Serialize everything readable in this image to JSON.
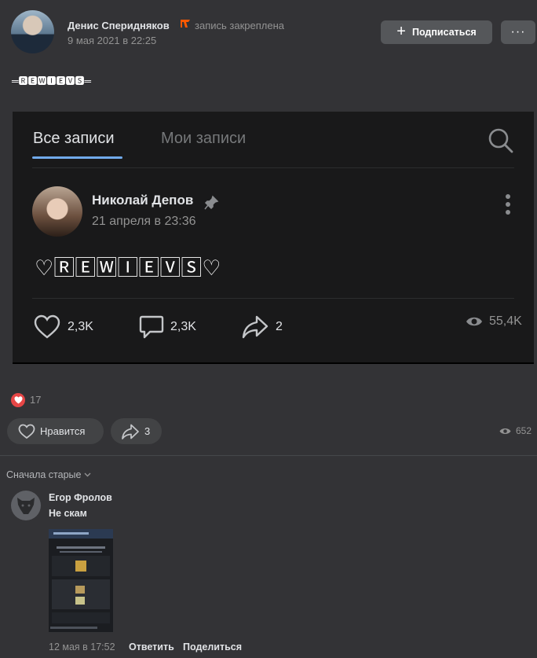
{
  "post": {
    "author": "Денис Сперидняков",
    "pinned_text": "запись закреплена",
    "date": "9 мая 2021 в 22:25",
    "subscribe_label": "Подписаться",
    "more_label": "···",
    "text": "═🆁🅴🆆🅸🅴🆅🆂═"
  },
  "embedded_screenshot": {
    "tab_all": "Все записи",
    "tab_mine": "Мои записи",
    "author": "Николай Депов",
    "date": "21 апреля в 23:36",
    "text": "♡🅁🄴🅆🄸🄴🅅🅂♡",
    "likes": "2,3K",
    "comments": "2,3K",
    "shares": "2",
    "views": "55,4K"
  },
  "reactions": {
    "count": "17",
    "icon": "heart-reaction-icon",
    "color": "#e64646"
  },
  "actions": {
    "like_label": "Нравится",
    "share_count": "3",
    "views": "652"
  },
  "comments": {
    "sort_label": "Сначала старые",
    "items": [
      {
        "author": "Егор Фролов",
        "text": "Не скам",
        "date": "12 мая в 17:52",
        "reply_label": "Ответить",
        "share_label": "Поделиться"
      }
    ]
  },
  "colors": {
    "accent": "#71aaeb",
    "background": "#333336",
    "button": "#55575a"
  }
}
